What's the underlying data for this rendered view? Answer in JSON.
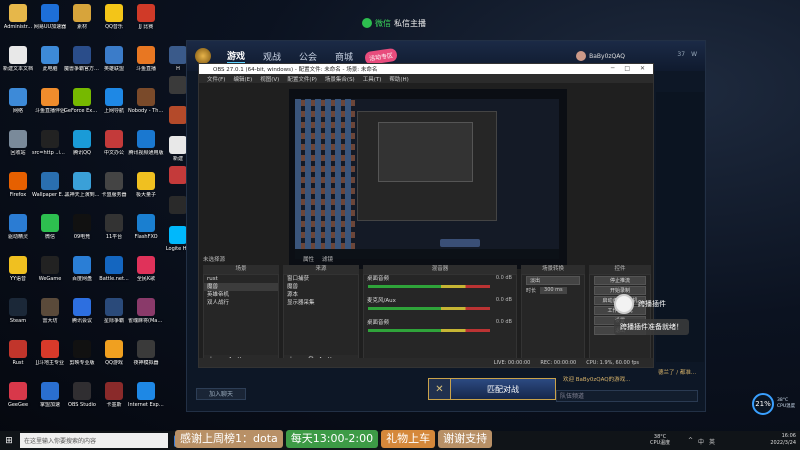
{
  "chat_tab": {
    "brand": "微信",
    "label": "私信主播"
  },
  "desktop_icons": [
    {
      "label": "Administr...",
      "color": "#e6b74a"
    },
    {
      "label": "网易UU加速器",
      "color": "#1d6fd8"
    },
    {
      "label": "素材",
      "color": "#d7a43b"
    },
    {
      "label": "QQ音乐",
      "color": "#f3c518"
    },
    {
      "label": "JJ 比赛",
      "color": "#d03a28"
    },
    {
      "label": "新建文本文档",
      "color": "#e8e8e8"
    },
    {
      "label": "此电脑",
      "color": "#3d8ad8"
    },
    {
      "label": "魔兽争霸官方对战平台",
      "color": "#2a4d8a"
    },
    {
      "label": "英雄联盟",
      "color": "#3b7cc9"
    },
    {
      "label": "斗鱼直播",
      "color": "#e87722"
    },
    {
      "label": "网络",
      "color": "#3d8ad8"
    },
    {
      "label": "斗鱼直播伴侣",
      "color": "#f08c2c"
    },
    {
      "label": "GeForce Experience",
      "color": "#76b900"
    },
    {
      "label": "上网导航",
      "color": "#1e88e5"
    },
    {
      "label": "Nobody - The Turna...",
      "color": "#7a4a2a"
    },
    {
      "label": "回收站",
      "color": "#7a8a9a"
    },
    {
      "label": "src=http ..img.ketpd...",
      "color": "#222222"
    },
    {
      "label": "腾讯QQ",
      "color": "#1a9bd7"
    },
    {
      "label": "中文办公",
      "color": "#c33a3a"
    },
    {
      "label": "腾讯视频通用版",
      "color": "#1a78d0"
    },
    {
      "label": "Firefox",
      "color": "#e66000"
    },
    {
      "label": "Wallpaper Engine: ...",
      "color": "#2a6fb0"
    },
    {
      "label": "黑神天上演到...",
      "color": "#3aa0d8"
    },
    {
      "label": "卡盟服务器",
      "color": "#444444"
    },
    {
      "label": "极大量子",
      "color": "#f0c020"
    },
    {
      "label": "驱动精灵",
      "color": "#2b7cd3"
    },
    {
      "label": "微信",
      "color": "#2dbf4f"
    },
    {
      "label": "09电竞",
      "color": "#111111"
    },
    {
      "label": "11平台",
      "color": "#333333"
    },
    {
      "label": "FlashFXO",
      "color": "#1a7fd0"
    },
    {
      "label": "YY语音",
      "color": "#f0c020"
    },
    {
      "label": "WeGame",
      "color": "#222222"
    },
    {
      "label": "百度网盘",
      "color": "#2a7ed6"
    },
    {
      "label": "Battle.net...",
      "color": "#1466c0"
    },
    {
      "label": "全民K歌",
      "color": "#e0325a"
    },
    {
      "label": "Steam",
      "color": "#1b2838"
    },
    {
      "label": "雷大坊",
      "color": "#5a4a3a"
    },
    {
      "label": "腾讯会议",
      "color": "#2d6fe0"
    },
    {
      "label": "星际争霸",
      "color": "#2a4a7a"
    },
    {
      "label": "雀魂麻将(Mahjong...",
      "color": "#8a3a6a"
    },
    {
      "label": "Rust",
      "color": "#c1352b"
    },
    {
      "label": "JJ斗地主专业",
      "color": "#d83a2a"
    },
    {
      "label": "剪映专业版",
      "color": "#111111"
    },
    {
      "label": "QQ游戏",
      "color": "#f0a020"
    },
    {
      "label": "夜神模拟器",
      "color": "#3a3a3a"
    },
    {
      "label": "GeeGee",
      "color": "#d8384a"
    },
    {
      "label": "掌盟加速",
      "color": "#2a6fd0"
    },
    {
      "label": "OBS Studio",
      "color": "#302e31"
    },
    {
      "label": "卡墨斯",
      "color": "#8a2a2a"
    },
    {
      "label": "Internet Explorer",
      "color": "#1e88e5"
    }
  ],
  "side_icons": [
    {
      "label": "H",
      "color": "#3a5a8a"
    },
    {
      "label": "",
      "color": "#3a3a3a"
    },
    {
      "label": "",
      "color": "#b44a2a"
    },
    {
      "label": "新建",
      "color": "#e8e8e8"
    },
    {
      "label": "",
      "color": "#c43a3a"
    },
    {
      "label": "",
      "color": "#2a2a2a"
    },
    {
      "label": "Logite HU",
      "color": "#00b8fc"
    }
  ],
  "client": {
    "tabs": [
      "游戏",
      "观战",
      "公会",
      "商城"
    ],
    "badge": "活动专区",
    "user": "BaBy0zQAQ",
    "stats": [
      "37",
      "W"
    ]
  },
  "obs": {
    "title": "OBS 27.0.1 (64-bit, windows) - 配置文件: 未命名 - 场景: 未命名",
    "window_controls": "─ □ ✕",
    "menu": [
      "文件(F)",
      "编辑(E)",
      "视图(V)",
      "配置文件(P)",
      "场景集合(S)",
      "工具(T)",
      "帮助(H)"
    ],
    "source_bar": {
      "label": "未选择源",
      "props": "属性",
      "filter": "滤镜"
    },
    "scenes_title": "场景",
    "scenes": [
      "rust",
      "魔兽",
      "英雄帝机",
      "双人战行"
    ],
    "sources_title": "来源",
    "sources": [
      "窗口捕获",
      "魔兽",
      "源本",
      "显示器采集"
    ],
    "mixer_title": "混音器",
    "mixer": [
      {
        "name": "桌面音频",
        "db": "0.0 dB"
      },
      {
        "name": "麦克风/Aux",
        "db": "0.0 dB"
      },
      {
        "name": "桌面音频",
        "db": "0.0 dB"
      }
    ],
    "transition_title": "场景转换",
    "transition": {
      "type": "淡出",
      "duration_label": "时长",
      "duration": "300 ms"
    },
    "controls_title": "控件",
    "controls": [
      "停止推流",
      "开始录制",
      "启动虚拟摄像机",
      "工作室模式",
      "设置",
      "退出"
    ],
    "status": {
      "live": "LIVE: 00:00:00",
      "rec": "REC: 00:00:00",
      "cpu": "CPU: 1.9%, 60.00 fps"
    }
  },
  "match_button": "匹配对战",
  "invite_button": "加入聊天",
  "chat_line": "欢迎 BaBy0zQAQ的游戏...",
  "side_chat_line": "德兰了 / 都准...",
  "chat_input_placeholder": "队伍频道",
  "plugin": {
    "title": "跨播插件",
    "message": "跨播插件准备就绪！"
  },
  "perf": {
    "value": "21%",
    "temp": "38°C",
    "label": "CPU温度"
  },
  "taskbar": {
    "search_placeholder": "在这里输入你要搜索的内容",
    "temp": "38°C",
    "temp_label": "CPU温度",
    "time": "16:06",
    "date": "2022/3/24",
    "tray": [
      "^",
      "中",
      "英"
    ]
  },
  "overlay": {
    "items": [
      "感谢上周榜1：dota",
      "每天13:00-2:00",
      "礼物上车",
      "谢谢支持"
    ]
  }
}
